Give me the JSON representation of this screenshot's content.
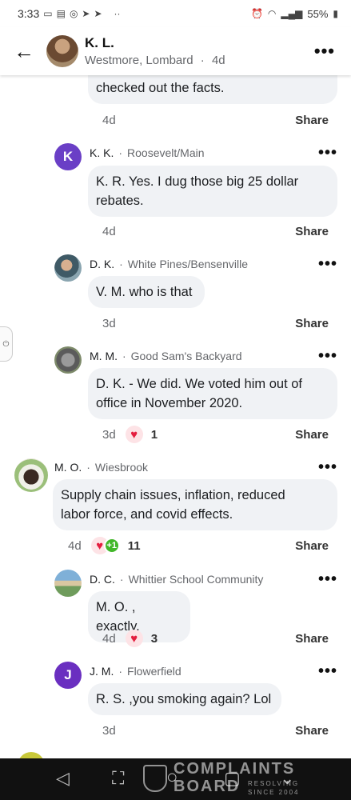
{
  "status_bar": {
    "time": "3:33",
    "battery": "55%"
  },
  "header": {
    "name": "K. L.",
    "location": "Westmore, Lombard",
    "age": "4d"
  },
  "top_comment": {
    "text": "checked out the facts.",
    "time": "4d",
    "share": "Share"
  },
  "comments": [
    {
      "initial": "K",
      "name": "K. K.",
      "location": "Roosevelt/Main",
      "lines": [
        "K. R. Yes. I dug those big 25 dollar",
        "rebates."
      ],
      "time": "4d",
      "share": "Share",
      "reactions": ""
    },
    {
      "initial": "",
      "name": "D. K.",
      "location": "White Pines/Bensenville",
      "lines": [
        "V. M. who is that"
      ],
      "time": "3d",
      "share": "Share",
      "reactions": ""
    },
    {
      "initial": "",
      "name": "M. M.",
      "location": "Good Sam's Backyard",
      "lines": [
        "D. K. - We did.  We voted him out of",
        "office in November 2020."
      ],
      "time": "3d",
      "share": "Share",
      "reactions": "1"
    },
    {
      "initial": "",
      "name": "M. O.",
      "location": "Wiesbrook",
      "lines": [
        "Supply chain issues, inflation, reduced",
        "labor force, and covid effects."
      ],
      "time": "4d",
      "share": "Share",
      "reactions": "11"
    },
    {
      "initial": "",
      "name": "D. C.",
      "location": "Whittier School Community",
      "lines": [
        "M. O. , exactly."
      ],
      "time": "4d",
      "share": "Share",
      "reactions": "3"
    },
    {
      "initial": "J",
      "name": "J. M.",
      "location": "Flowerfield",
      "lines": [
        "R. S. ,you smoking again? Lol"
      ],
      "time": "3d",
      "share": "Share",
      "reactions": ""
    }
  ],
  "plus_one": "+1",
  "watermark": {
    "line1": "COMPLAINTS",
    "line2": "BOARD",
    "tag1": "RESOLVING",
    "tag2": "SINCE 2004"
  },
  "colors": {
    "k_avatar": "#6a3fc6",
    "j_avatar": "#6a2fc0",
    "heart": "#e41e3f"
  }
}
